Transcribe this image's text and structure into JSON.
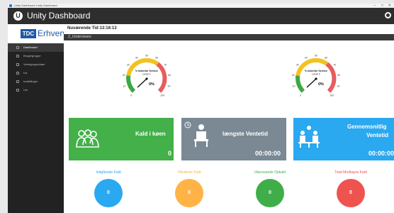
{
  "window": {
    "title": "Unity Dashboard Unity Dashboard",
    "controls": [
      "–",
      "□",
      "✕"
    ]
  },
  "app": {
    "title": "Unity Dashboard",
    "logo_letter": "U"
  },
  "brand": {
    "badge": "TDC",
    "name": "Erhverv"
  },
  "sidebar": {
    "items": [
      {
        "label": "Dashboard",
        "active": true
      },
      {
        "label": "Brugergruppe",
        "active": false
      },
      {
        "label": "Ventegruppekøer",
        "active": false
      },
      {
        "label": "Kø",
        "active": false
      },
      {
        "label": "Indstillinger",
        "active": false
      },
      {
        "label": "Ure",
        "active": false
      }
    ]
  },
  "header": {
    "time": "Nuværende Tid:13:16:13",
    "section": "Z_Undervisere"
  },
  "gauges": [
    {
      "title": "% Indenfor Service",
      "level": "Level 1",
      "value": "0%",
      "ticks": [
        "0",
        "10",
        "20",
        "30",
        "40",
        "50",
        "60",
        "70",
        "80",
        "90",
        "100"
      ]
    },
    {
      "title": "% Indenfor Service",
      "level": "Level 2",
      "value": "0%",
      "ticks": [
        "0",
        "10",
        "20",
        "30",
        "40",
        "50",
        "60",
        "70",
        "80",
        "90",
        "100"
      ]
    }
  ],
  "cards": [
    {
      "title": "Kald i køen",
      "value": "0",
      "color": "#43b04a",
      "icon": "group-icon"
    },
    {
      "title": "længste Ventetid",
      "value": "00:00:00",
      "color": "#7a8994",
      "icon": "waiting-person-icon"
    },
    {
      "title_line1": "Gennemsnitlig",
      "title_line2": "Ventetid",
      "value": "00:00:00",
      "color": "#2aa8f0",
      "icon": "waiting-room-icon"
    }
  ],
  "stats": [
    {
      "label": "Indgående Kald",
      "value": "0",
      "color": "#2aa8f0"
    },
    {
      "label": "Håndtede Kald",
      "value": "0",
      "color": "#ffb347"
    },
    {
      "label": "Ubesvarede Opkald",
      "value": "0",
      "color": "#3fae49"
    },
    {
      "label": "Total Modtagne Kald",
      "value": "0",
      "color": "#ef5350"
    }
  ]
}
